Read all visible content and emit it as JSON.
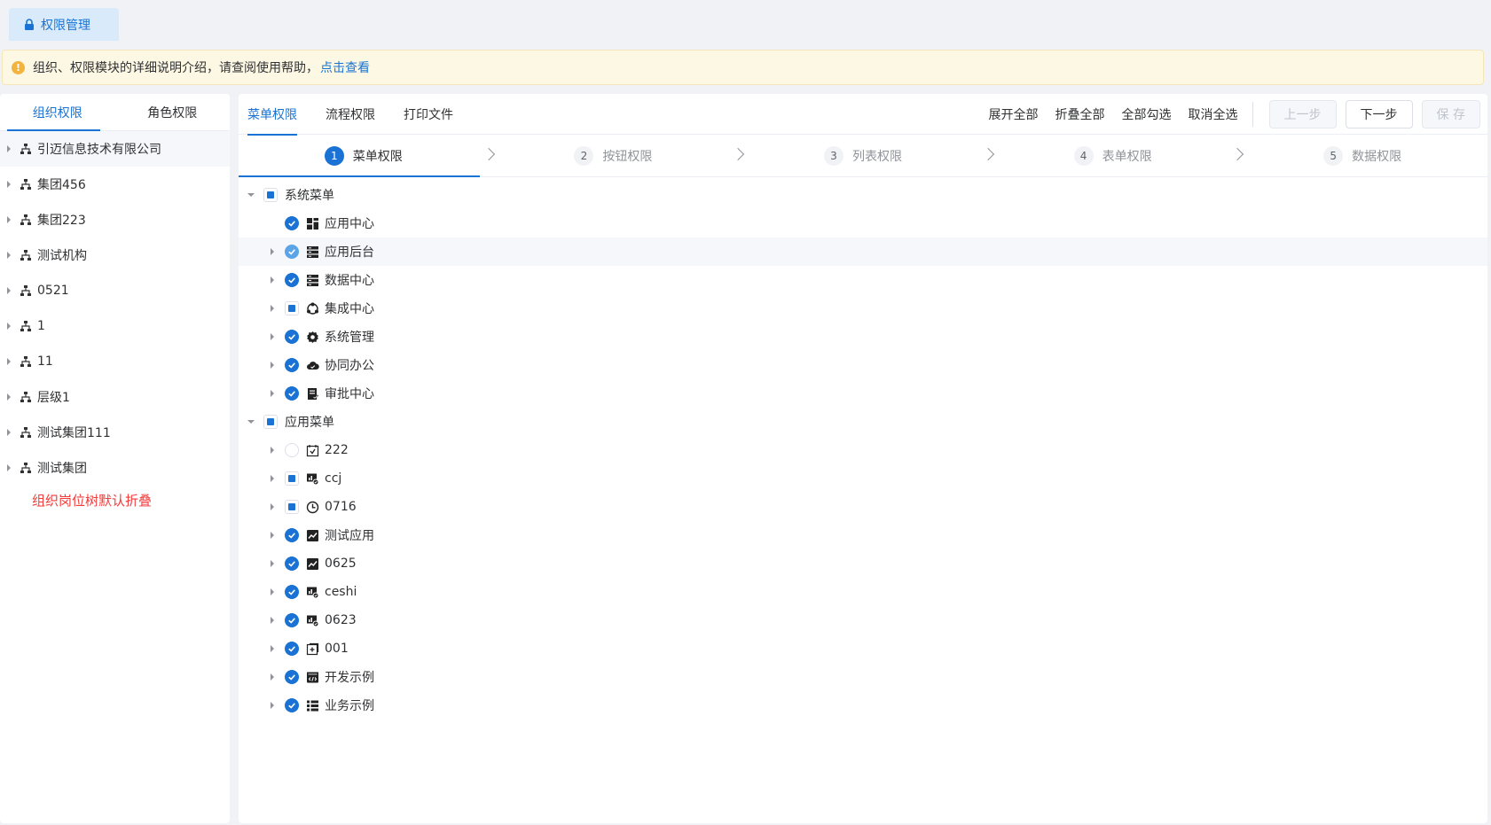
{
  "top_tab": {
    "label": "权限管理"
  },
  "notice": {
    "text": "组织、权限模块的详细说明介绍，请查阅使用帮助，",
    "link": "点击查看"
  },
  "left": {
    "tabs": [
      "组织权限",
      "角色权限"
    ],
    "orgs": [
      "引迈信息技术有限公司",
      "集团456",
      "集团223",
      "测试机构",
      "0521",
      "1",
      "11",
      "层级1",
      "测试集团111",
      "测试集团"
    ],
    "note": "组织岗位树默认折叠"
  },
  "right": {
    "tabs": [
      "菜单权限",
      "流程权限",
      "打印文件"
    ],
    "actions": [
      "展开全部",
      "折叠全部",
      "全部勾选",
      "取消全选"
    ],
    "buttons": {
      "prev": "上一步",
      "next": "下一步",
      "save": "保 存"
    },
    "steps": [
      {
        "num": "1",
        "label": "菜单权限"
      },
      {
        "num": "2",
        "label": "按钮权限"
      },
      {
        "num": "3",
        "label": "列表权限"
      },
      {
        "num": "4",
        "label": "表单权限"
      },
      {
        "num": "5",
        "label": "数据权限"
      }
    ],
    "tree": {
      "system": {
        "label": "系统菜单",
        "state": "half"
      },
      "system_items": [
        {
          "label": "应用中心",
          "icon": "grid-icon",
          "state": "checked"
        },
        {
          "label": "应用后台",
          "icon": "server-icon",
          "state": "checked"
        },
        {
          "label": "数据中心",
          "icon": "server-icon",
          "state": "checked"
        },
        {
          "label": "集成中心",
          "icon": "integration-icon",
          "state": "half"
        },
        {
          "label": "系统管理",
          "icon": "gear-icon",
          "state": "checked"
        },
        {
          "label": "协同办公",
          "icon": "cloud-icon",
          "state": "checked"
        },
        {
          "label": "审批中心",
          "icon": "approval-icon",
          "state": "checked"
        }
      ],
      "app": {
        "label": "应用菜单",
        "state": "half"
      },
      "app_items": [
        {
          "label": "222",
          "icon": "calendar-check-icon",
          "state": "empty"
        },
        {
          "label": "ccj",
          "icon": "dashboard-icon",
          "state": "half"
        },
        {
          "label": "0716",
          "icon": "clock-icon",
          "state": "half"
        },
        {
          "label": "测试应用",
          "icon": "chart-icon",
          "state": "checked"
        },
        {
          "label": "0625",
          "icon": "chart-icon",
          "state": "checked"
        },
        {
          "label": "ceshi",
          "icon": "dashboard-icon",
          "state": "checked"
        },
        {
          "label": "0623",
          "icon": "dashboard-icon",
          "state": "checked"
        },
        {
          "label": "001",
          "icon": "plus-box-icon",
          "state": "checked"
        },
        {
          "label": "开发示例",
          "icon": "code-icon",
          "state": "checked"
        },
        {
          "label": "业务示例",
          "icon": "list-icon",
          "state": "checked"
        }
      ]
    }
  }
}
